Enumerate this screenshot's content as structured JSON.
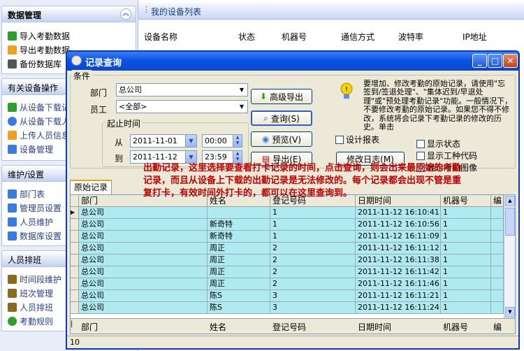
{
  "sidebar": {
    "sections": [
      {
        "title": "数据管理",
        "items": [
          {
            "label": "导入考勤数据",
            "icon": "import-arrow-icon",
            "color": "#2e9e2e"
          },
          {
            "label": "导出考勤数据",
            "icon": "export-arrow-icon",
            "color": "#f0a020"
          },
          {
            "label": "备份数据库",
            "icon": "backup-database-icon",
            "color": "#555555"
          }
        ]
      },
      {
        "title": "有关设备操作",
        "items": [
          {
            "label": "从设备下载记录",
            "icon": "download-arrow-icon",
            "color": "#2e9e2e"
          },
          {
            "label": "从设备下载人员",
            "icon": "download-user-icon",
            "color": "#3a7be0"
          },
          {
            "label": "上传人员信息",
            "icon": "upload-arrow-icon",
            "color": "#f0a020"
          },
          {
            "label": "设备管理",
            "icon": "device-gear-icon",
            "color": "#3a7be0"
          }
        ]
      },
      {
        "title": "维护/设置",
        "items": [
          {
            "label": "部门表",
            "icon": "department-icon",
            "color": "#3a7be0"
          },
          {
            "label": "管理员设置",
            "icon": "admin-icon",
            "color": "#3a7be0"
          },
          {
            "label": "人员维护",
            "icon": "user-icon",
            "color": "#3a7be0"
          },
          {
            "label": "数据库设置",
            "icon": "database-icon",
            "color": "#3a7be0"
          }
        ]
      },
      {
        "title": "人员排班",
        "items": [
          {
            "label": "时间段维护",
            "icon": "time-period-icon",
            "color": "#8a6a20"
          },
          {
            "label": "班次管理",
            "icon": "shift-icon",
            "color": "#8a6a20"
          },
          {
            "label": "人员排班",
            "icon": "schedule-icon",
            "color": "#8a6a20"
          },
          {
            "label": "考勤规则",
            "icon": "rules-icon",
            "color": "#2e9e2e"
          }
        ]
      }
    ]
  },
  "device_list": {
    "title": "我的设备列表",
    "columns": [
      "设备名称",
      "状态",
      "机器号",
      "通信方式",
      "波特率",
      "IP地址"
    ]
  },
  "dialog": {
    "title": "记录查询",
    "condition_label": "条件",
    "dept_label": "部门",
    "dept_value": "总公司",
    "staff_label": "员工",
    "staff_value": "<全部>",
    "time_group_label": "起止时间",
    "from_label": "从",
    "from_date": "2011-11-01",
    "from_time": "00:00",
    "to_label": "到",
    "to_date": "2011-11-12",
    "to_time": "23:59",
    "buttons": {
      "advanced_export": "高级导出",
      "query": "查询(S)",
      "preview": "预览(V)",
      "export": "导出(E)",
      "modify_log": "修改日志(M)"
    },
    "design_report": "设计报表",
    "show_status": "显示状态",
    "show_work_code": "显示工种代码",
    "show_photo": "显示所拍图像",
    "tip_text": "要增加、修改考勤的原始记录，请使用\"忘签到/签退处理\"、\"集体迟到/早退处理\"或\"预处理考勤记录\"功能。一般情况下，不要修改考勤的原始记录。如果您不得不修改，系统将会记录下考勤记录的修改的历史。单击",
    "tab_label": "原始记录",
    "annotation": "出勤记录，这里选择要查看打卡记录的时间，点击查询，则会出来最原始的考勤记录，而且从设备上下载的出勤记录是无法修改的。每个记录都会出现不管是重复打卡，有效时间外打卡的，都可以在这里查询到。",
    "grid": {
      "columns": [
        "部门",
        "姓名",
        "登记号码",
        "日期时间",
        "机器号",
        "编"
      ],
      "rows": [
        [
          "总公司",
          "",
          "1",
          "2011-11-12  16:10:41",
          "1"
        ],
        [
          "总公司",
          "新奇特",
          "1",
          "2011-11-12  16:10:56",
          "1"
        ],
        [
          "总公司",
          "新奇特",
          "1",
          "2011-11-12  16:11:09",
          "1"
        ],
        [
          "总公司",
          "周正",
          "2",
          "2011-11-12  16:11:12",
          "1"
        ],
        [
          "总公司",
          "周正",
          "2",
          "2011-11-12  16:11:38",
          "1"
        ],
        [
          "总公司",
          "周正",
          "2",
          "2011-11-12  16:11:42",
          "1"
        ],
        [
          "总公司",
          "周正",
          "2",
          "2011-11-12  16:11:46",
          "1"
        ],
        [
          "总公司",
          "陈S",
          "3",
          "2011-11-12  16:11:21",
          "1"
        ],
        [
          "总公司",
          "陈S",
          "3",
          "2011-11-12  16:11:24",
          "1"
        ]
      ],
      "footer_columns": [
        "部门",
        "姓名",
        "登记号码",
        "日期时间",
        "机器号",
        "编"
      ]
    },
    "status_count": "10"
  }
}
